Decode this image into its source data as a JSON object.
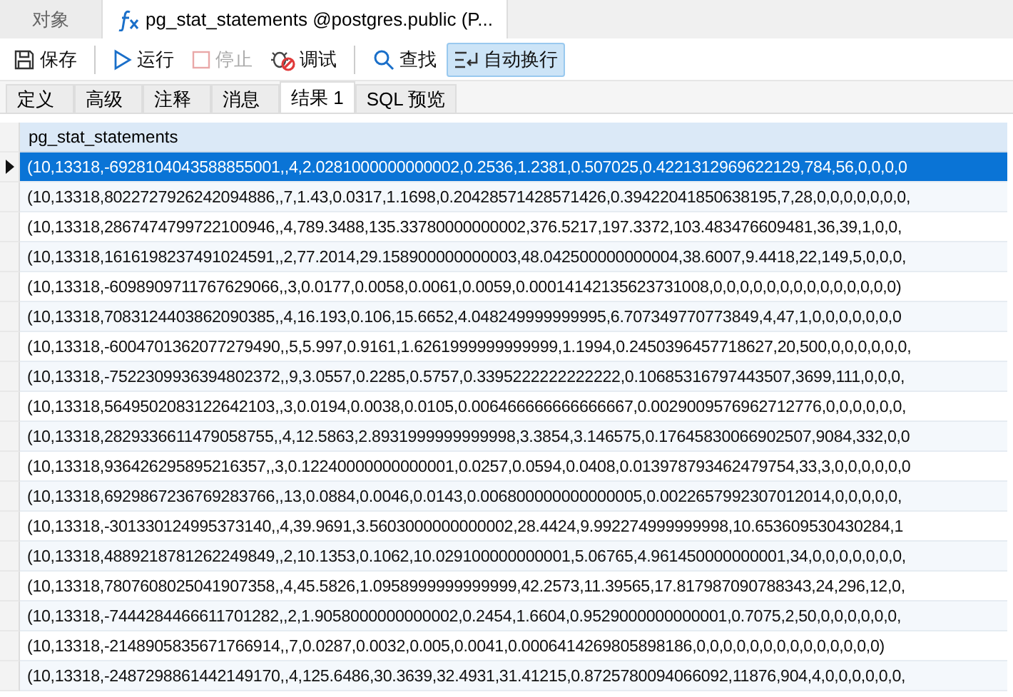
{
  "doc_tabs": [
    {
      "label": "对象",
      "selected": false
    },
    {
      "label": "pg_stat_statements @postgres.public (P...",
      "selected": true
    }
  ],
  "toolbar": [
    {
      "kind": "button",
      "label": "保存",
      "disabled": false,
      "selected": false
    },
    {
      "kind": "separator"
    },
    {
      "kind": "button",
      "label": "运行",
      "disabled": false,
      "selected": false
    },
    {
      "kind": "button",
      "label": "停止",
      "disabled": true,
      "selected": false
    },
    {
      "kind": "button",
      "label": "调试",
      "disabled": false,
      "selected": false
    },
    {
      "kind": "separator"
    },
    {
      "kind": "button",
      "label": "查找",
      "disabled": false,
      "selected": false
    },
    {
      "kind": "button",
      "label": "自动换行",
      "disabled": false,
      "selected": true
    }
  ],
  "sub_tabs": [
    {
      "label": "定义",
      "selected": false
    },
    {
      "label": "高级",
      "selected": false
    },
    {
      "label": "注释",
      "selected": false
    },
    {
      "label": "消息",
      "selected": false
    },
    {
      "label": "结果 1",
      "selected": true
    },
    {
      "label": "SQL 预览",
      "selected": false
    }
  ],
  "table": {
    "columns": [
      "pg_stat_statements"
    ],
    "rows": [
      {
        "value": "(10,13318,-6928104043588855001,,4,2.0281000000000002,0.2536,1.2381,0.507025,0.4221312969622129,784,56,0,0,0,0",
        "selected": true
      },
      {
        "value": "(10,13318,8022727926242094886,,7,1.43,0.0317,1.1698,0.20428571428571426,0.39422041850638195,7,28,0,0,0,0,0,0,0,",
        "selected": false
      },
      {
        "value": "(10,13318,2867474799722100946,,4,789.3488,135.33780000000002,376.5217,197.3372,103.483476609481,36,39,1,0,0,",
        "selected": false
      },
      {
        "value": "(10,13318,1616198237491024591,,2,77.2014,29.158900000000003,48.042500000000004,38.6007,9.4418,22,149,5,0,0,0,",
        "selected": false
      },
      {
        "value": "(10,13318,-6098909711767629066,,3,0.0177,0.0058,0.0061,0.0059,0.00014142135623731008,0,0,0,0,0,0,0,0,0,0,0,0,0,0)",
        "selected": false
      },
      {
        "value": "(10,13318,7083124403862090385,,4,16.193,0.106,15.6652,4.048249999999995,6.707349770773849,4,47,1,0,0,0,0,0,0,0",
        "selected": false
      },
      {
        "value": "(10,13318,-6004701362077279490,,5,5.997,0.9161,1.6261999999999999,1.1994,0.2450396457718627,20,500,0,0,0,0,0,0,",
        "selected": false
      },
      {
        "value": "(10,13318,-7522309936394802372,,9,3.0557,0.2285,0.5757,0.3395222222222222,0.10685316797443507,3699,111,0,0,0,",
        "selected": false
      },
      {
        "value": "(10,13318,5649502083122642103,,3,0.0194,0.0038,0.0105,0.006466666666666667,0.0029009576962712776,0,0,0,0,0,0,",
        "selected": false
      },
      {
        "value": "(10,13318,2829336611479058755,,4,12.5863,2.8931999999999998,3.3854,3.146575,0.17645830066902507,9084,332,0,0",
        "selected": false
      },
      {
        "value": "(10,13318,936426295895216357,,3,0.12240000000000001,0.0257,0.0594,0.0408,0.013978793462479754,33,3,0,0,0,0,0,0",
        "selected": false
      },
      {
        "value": "(10,13318,6929867236769283766,,13,0.0884,0.0046,0.0143,0.006800000000000005,0.0022657992307012014,0,0,0,0,0,",
        "selected": false
      },
      {
        "value": "(10,13318,-301330124995373140,,4,39.9691,3.5603000000000002,28.4424,9.992274999999998,10.653609530430284,1",
        "selected": false
      },
      {
        "value": "(10,13318,4889218781262249849,,2,10.1353,0.1062,10.029100000000001,5.06765,4.961450000000001,34,0,0,0,0,0,0,0,",
        "selected": false
      },
      {
        "value": "(10,13318,7807608025041907358,,4,45.5826,1.0958999999999999,42.2573,11.39565,17.817987090788343,24,296,12,0,",
        "selected": false
      },
      {
        "value": "(10,13318,-7444284466611701282,,2,1.9058000000000002,0.2454,1.6604,0.9529000000000001,0.7075,2,50,0,0,0,0,0,0,",
        "selected": false
      },
      {
        "value": "(10,13318,-2148905835671766914,,7,0.0287,0.0032,0.005,0.0041,0.0006414269805898186,0,0,0,0,0,0,0,0,0,0,0,0,0,0)",
        "selected": false
      },
      {
        "value": "(10,13318,-2487298861442149170,,4,125.6486,30.3639,32.4931,31.41215,0.8725780094066092,11876,904,4,0,0,0,0,0,0,",
        "selected": false
      }
    ]
  }
}
